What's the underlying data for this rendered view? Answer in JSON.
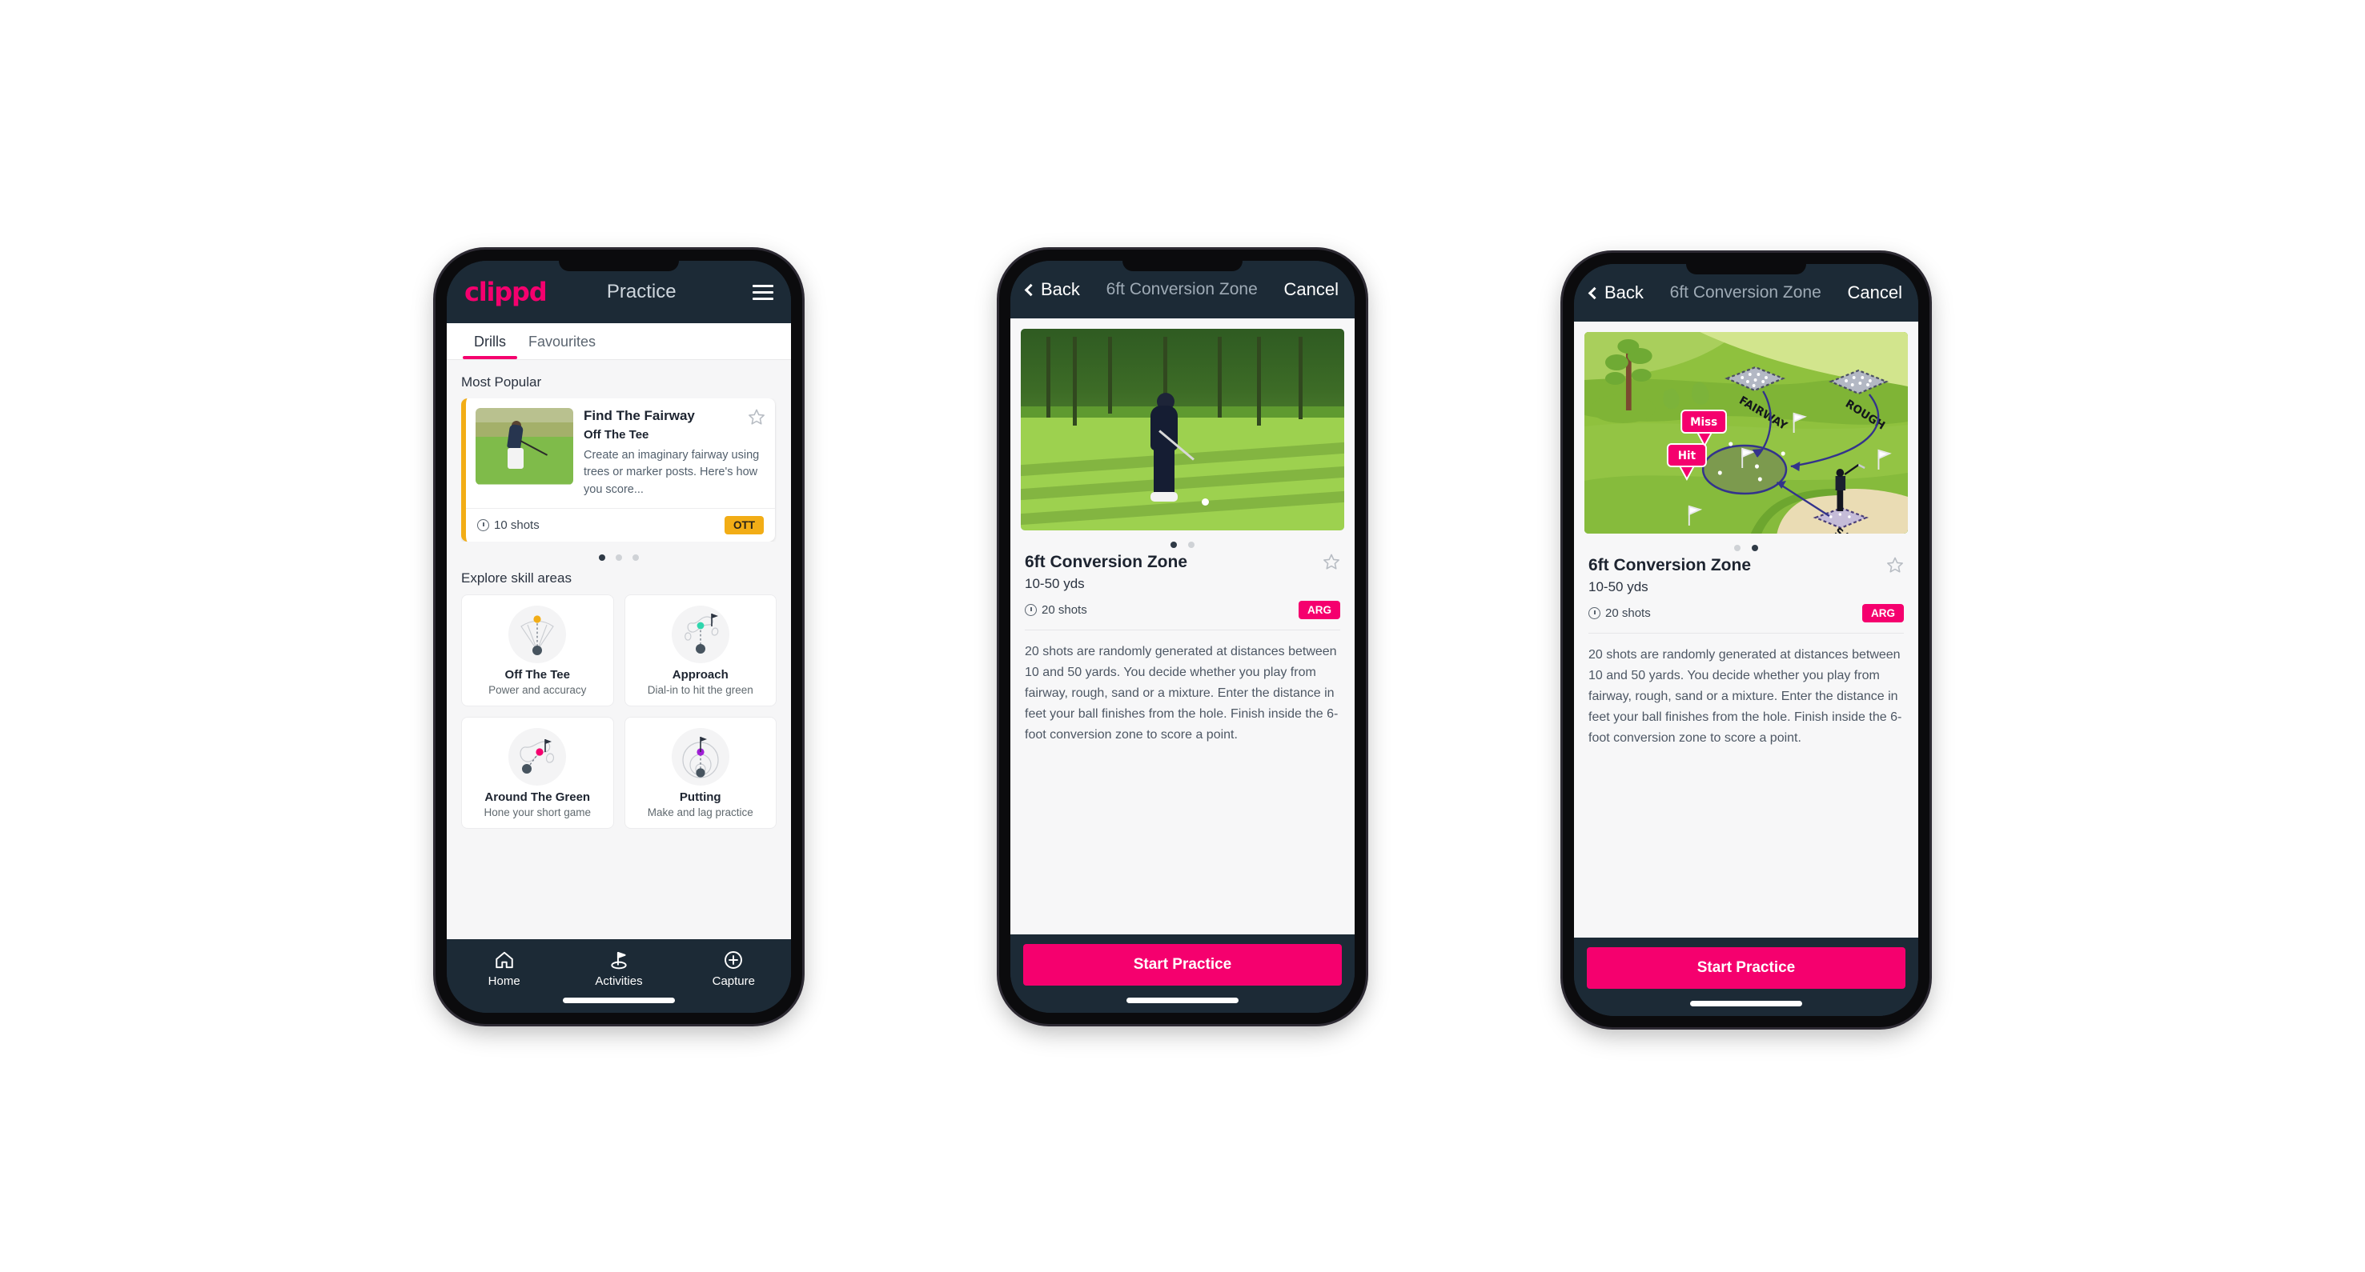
{
  "phone1": {
    "appbar": {
      "logo": "clippd",
      "title": "Practice",
      "menu_icon": "hamburger-icon"
    },
    "tabs": [
      {
        "label": "Drills",
        "active": true
      },
      {
        "label": "Favourites",
        "active": false
      }
    ],
    "sections": {
      "most_popular_title": "Most Popular",
      "explore_title": "Explore skill areas"
    },
    "featured_drill": {
      "title": "Find The Fairway",
      "subtitle": "Off The Tee",
      "description": "Create an imaginary fairway using trees or marker posts. Here's how you score...",
      "shots": "10 shots",
      "badge": "OTT",
      "badge_color": "#f2ad16",
      "accent_color": "#f2ad16",
      "next_card_accent": "#3fe0bf",
      "favourite_icon": "star-outline-icon",
      "shots_icon": "clock-icon"
    },
    "carousel_dots": {
      "count": 3,
      "active": 0
    },
    "skill_areas": [
      {
        "name": "Off The Tee",
        "desc": "Power and accuracy",
        "icon": "tee-dispersion-icon",
        "dot_color": "#f2ad16"
      },
      {
        "name": "Approach",
        "desc": "Dial-in to hit the green",
        "icon": "approach-green-icon",
        "dot_color": "#2fd6ad"
      },
      {
        "name": "Around The Green",
        "desc": "Hone your short game",
        "icon": "chip-green-icon",
        "dot_color": "#f5006e"
      },
      {
        "name": "Putting",
        "desc": "Make and lag practice",
        "icon": "putting-rings-icon",
        "dot_color": "#a11fd6"
      }
    ],
    "bottom_nav": [
      {
        "label": "Home",
        "icon": "home-icon",
        "active": false
      },
      {
        "label": "Activities",
        "icon": "golf-flag-icon",
        "active": true
      },
      {
        "label": "Capture",
        "icon": "plus-circle-icon",
        "active": false
      }
    ]
  },
  "phone2": {
    "navbar": {
      "back": "Back",
      "title": "6ft Conversion Zone",
      "cancel": "Cancel",
      "back_icon": "chevron-left-icon"
    },
    "media_type": "photo",
    "media_dots": {
      "count": 2,
      "active": 0
    },
    "detail": {
      "title": "6ft Conversion Zone",
      "yards": "10-50 yds",
      "shots": "20 shots",
      "badge": "ARG",
      "badge_color": "#f5006e",
      "favourite_icon": "star-outline-icon",
      "shots_icon": "clock-icon",
      "description": "20 shots are randomly generated at distances between 10 and 50 yards. You decide whether you play from fairway, rough, sand or a mixture. Enter the distance in feet your ball finishes from the hole. Finish inside the 6-foot conversion zone to score a point."
    },
    "cta": "Start Practice",
    "cta_color": "#f5006e"
  },
  "phone3": {
    "navbar": {
      "back": "Back",
      "title": "6ft Conversion Zone",
      "cancel": "Cancel",
      "back_icon": "chevron-left-icon"
    },
    "media_type": "illustration",
    "illustration": {
      "zone_labels": [
        "FAIRWAY",
        "ROUGH",
        "SAND"
      ],
      "markers": [
        {
          "label": "Miss",
          "color": "#f5006e"
        },
        {
          "label": "Hit",
          "color": "#f5006e"
        }
      ]
    },
    "media_dots": {
      "count": 2,
      "active": 1
    },
    "detail": {
      "title": "6ft Conversion Zone",
      "yards": "10-50 yds",
      "shots": "20 shots",
      "badge": "ARG",
      "badge_color": "#f5006e",
      "favourite_icon": "star-outline-icon",
      "shots_icon": "clock-icon",
      "description": "20 shots are randomly generated at distances between 10 and 50 yards. You decide whether you play from fairway, rough, sand or a mixture. Enter the distance in feet your ball finishes from the hole. Finish inside the 6-foot conversion zone to score a point."
    },
    "cta": "Start Practice",
    "cta_color": "#f5006e"
  }
}
